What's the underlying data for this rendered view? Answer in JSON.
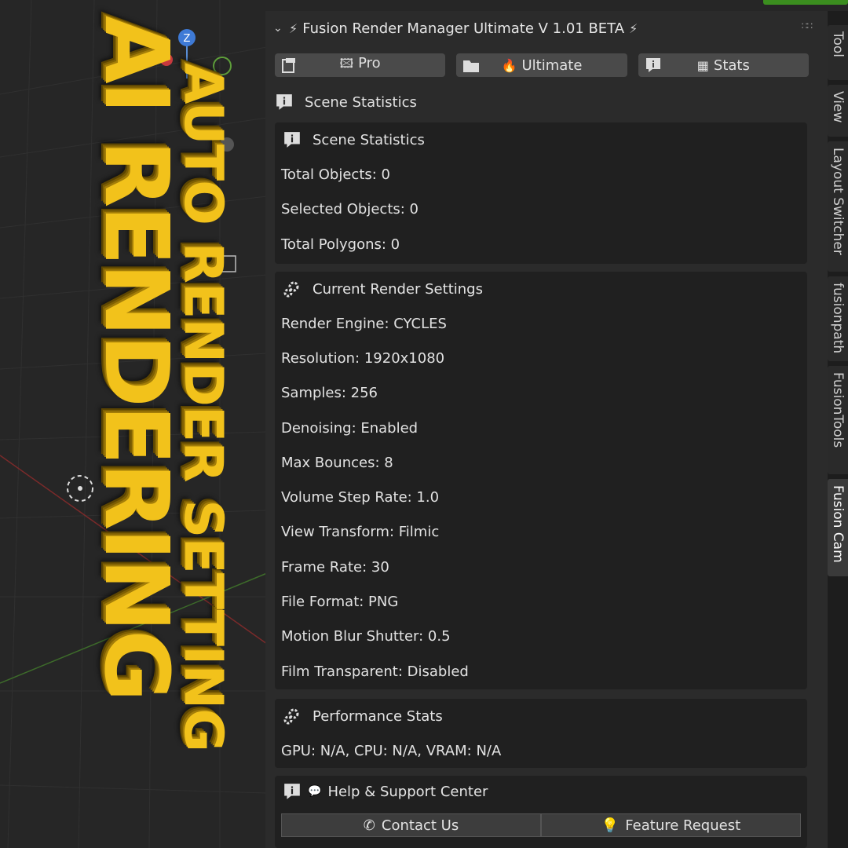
{
  "promo": {
    "line1": "AI RENDERING",
    "line2": "AUTO RENDER SETTING"
  },
  "panel": {
    "title": "Fusion Render Manager Ultimate V 1.01 BETA",
    "tabs": [
      {
        "label": "Pro",
        "icon": "film-icon",
        "glyph": "🖾"
      },
      {
        "label": "Ultimate",
        "icon": "folder-icon",
        "glyph": "🔥"
      },
      {
        "label": "Stats",
        "icon": "info-icon",
        "glyph": "▦"
      }
    ],
    "scene_header": "Scene Statistics",
    "scene_section": {
      "title": "Scene Statistics",
      "items": [
        "Total Objects: 0",
        "Selected Objects: 0",
        "Total Polygons: 0"
      ]
    },
    "render_section": {
      "title": "Current Render Settings",
      "items": [
        "Render Engine: CYCLES",
        "Resolution: 1920x1080",
        "Samples: 256",
        "Denoising: Enabled",
        "Max Bounces: 8",
        "Volume Step Rate: 1.0",
        "View Transform: Filmic",
        "Frame Rate: 30",
        "File Format: PNG",
        "Motion Blur Shutter: 0.5",
        "Film Transparent: Disabled"
      ]
    },
    "performance_section": {
      "title": "Performance Stats",
      "items": [
        "GPU: N/A, CPU: N/A, VRAM: N/A"
      ]
    },
    "help_section": {
      "title": "Help & Support Center",
      "buttons": [
        {
          "label": "Contact Us",
          "icon": "phone-icon"
        },
        {
          "label": "Feature Request",
          "icon": "lightbulb-icon"
        }
      ]
    }
  },
  "side_tabs": [
    "Tool",
    "View",
    "Layout Switcher",
    "fusionpath",
    "FusionTools",
    "Fusion Cam"
  ],
  "colors": {
    "promo_yellow": "#f2c21b",
    "panel_bg": "#2b2b2b",
    "section_bg": "#202020",
    "active_green": "#3b8e1f"
  }
}
